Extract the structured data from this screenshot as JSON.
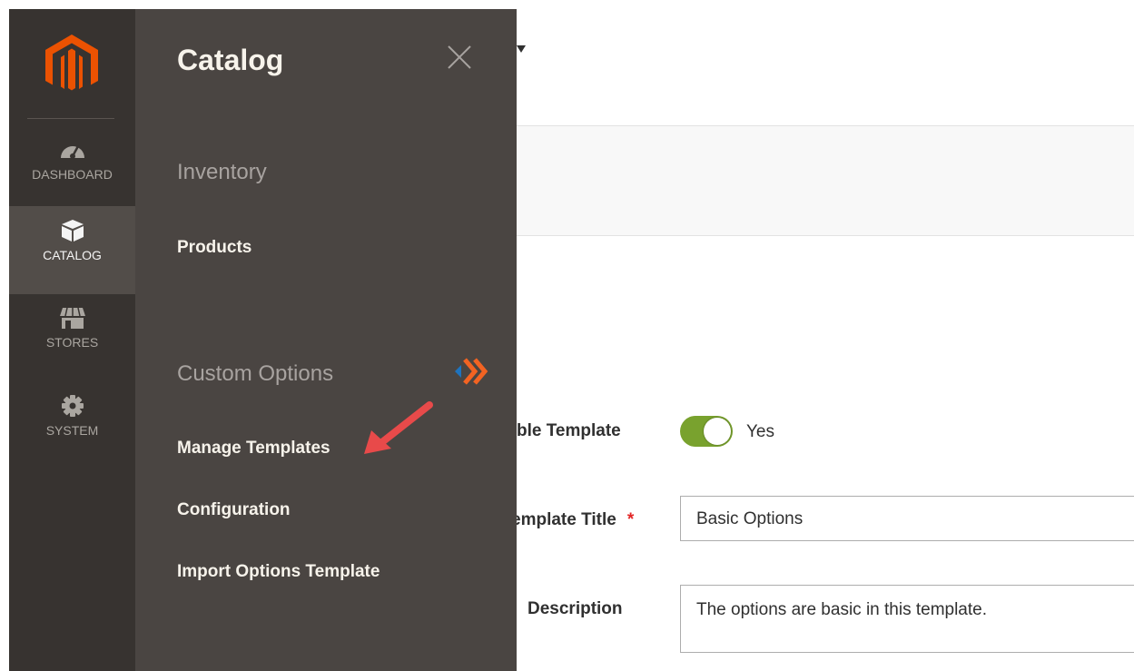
{
  "sidebar": {
    "logo_icon": "magento-logo-icon",
    "items": [
      {
        "label": "DASHBOARD",
        "icon": "speedometer-icon",
        "active": false
      },
      {
        "label": "CATALOG",
        "icon": "cube-icon",
        "active": true
      },
      {
        "label": "STORES",
        "icon": "storefront-icon",
        "active": false
      },
      {
        "label": "SYSTEM",
        "icon": "gear-icon",
        "active": false
      }
    ]
  },
  "flyout": {
    "title": "Catalog",
    "close_icon": "close-icon",
    "sections": [
      {
        "title": "Inventory",
        "links": [
          "Products"
        ]
      },
      {
        "title": "Custom Options",
        "icon": "double-chevron-icon",
        "links": [
          "Manage Templates",
          "Configuration",
          "Import Options Template"
        ]
      }
    ]
  },
  "form": {
    "enable_label": "ble Template",
    "enable_value": "Yes",
    "title_label": "emplate Title",
    "title_required": "*",
    "title_value": "Basic Options",
    "description_label": "Description",
    "description_value": "The options are basic in this template."
  },
  "colors": {
    "brand_orange": "#eb5202",
    "toggle_on": "#79a22e",
    "annotation_arrow": "#e84a4a"
  }
}
